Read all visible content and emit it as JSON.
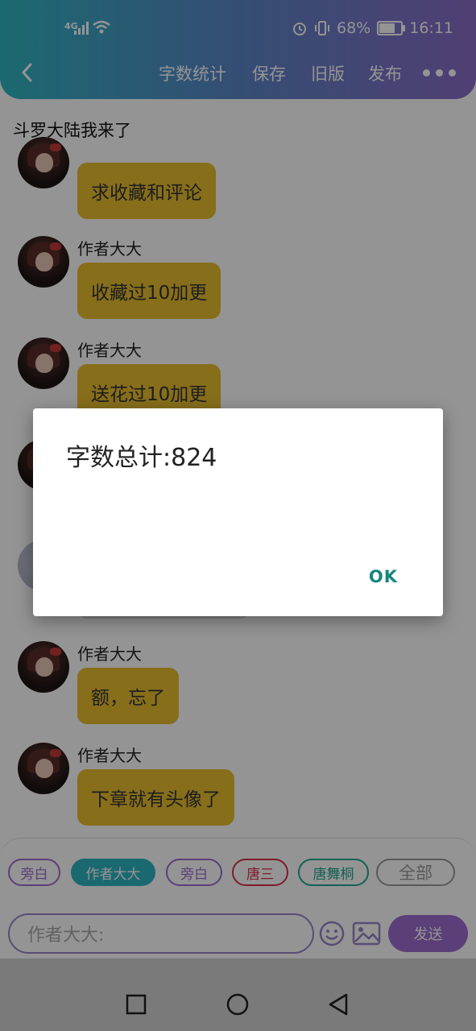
{
  "status_bar": {
    "network": "4G",
    "battery_percent": "68%",
    "battery_level": 0.68,
    "time": "16:11",
    "icons": [
      "signal-icon",
      "wifi-icon",
      "alarm-icon",
      "vibrate-icon",
      "battery-icon"
    ]
  },
  "toolbar": {
    "back_icon": "back-arrow-icon",
    "word_count_label": "字数统计",
    "save_label": "保存",
    "old_version_label": "旧版",
    "publish_label": "发布",
    "more_icon": "more-dots-icon"
  },
  "story": {
    "title": "斗罗大陆我来了"
  },
  "messages": [
    {
      "author": "",
      "text": "求收藏和评论"
    },
    {
      "author": "作者大大",
      "text": "收藏过10加更"
    },
    {
      "author": "作者大大",
      "text": "送花过10加更"
    },
    {
      "author": "作者大大",
      "text": "额，忘了"
    },
    {
      "author": "作者大大",
      "text": "下章就有头像了"
    }
  ],
  "character_chips": [
    {
      "label": "旁白",
      "color": "#9b6dd0",
      "selected": false
    },
    {
      "label": "作者大大",
      "color": "#2fb6c2",
      "selected": true
    },
    {
      "label": "旁白",
      "color": "#9b6dd0",
      "selected": false
    },
    {
      "label": "唐三",
      "color": "#d9304a",
      "selected": false
    },
    {
      "label": "唐舞桐",
      "color": "#1fa88f",
      "selected": false
    },
    {
      "label": "全部",
      "color": "#9a9a9a",
      "selected": false
    }
  ],
  "composer": {
    "placeholder": "作者大大:",
    "send_label": "发送",
    "emoji_icon": "emoji-icon",
    "image_icon": "image-icon"
  },
  "dialog": {
    "message": "字数总计:824",
    "ok_label": "OK"
  },
  "nav": {
    "recent": "square-icon",
    "home": "circle-icon",
    "back": "triangle-back-icon"
  }
}
